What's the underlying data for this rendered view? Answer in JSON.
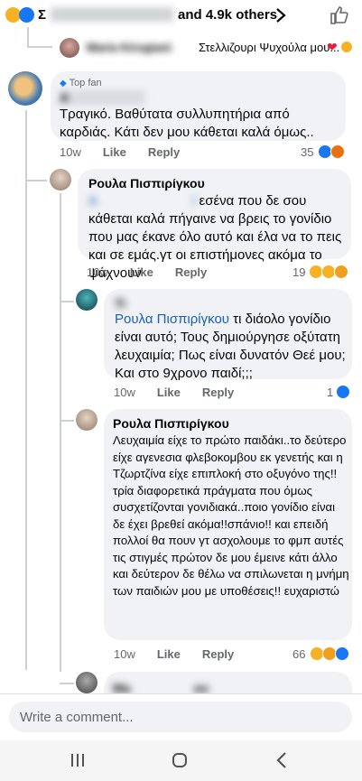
{
  "header": {
    "reactors_text": "Σ",
    "reactors_blur": "          ",
    "reactors_suffix": "and 4.9k others"
  },
  "preview_reply": {
    "name": "Maria Kirogiani",
    "text": "Στελλιζουρι Ψυχούλα μου..."
  },
  "comments": [
    {
      "badge": "Top fan",
      "name": "A      ",
      "text": "Τραγικό. Βαθύτατα συλλυπητήρια από καρδιάς. Κάτι δεν μου κάθεται καλά όμως..",
      "time": "10w",
      "like": "Like",
      "reply": "Reply",
      "reactions": "35"
    },
    {
      "name": "Ρουλα Πισπιρίγκου",
      "mention": "Α       ί",
      "text": " εσένα που δε σου κάθεται καλά πήγαινε να βρεις το γονίδιο που μας έκανε όλο αυτό και έλα να το πεις και σε εμάς.γτ οι επιστήμονες ακόμα το ψάχνουν",
      "time": "10w",
      "like": "Like",
      "reply": "Reply",
      "reactions": "19"
    },
    {
      "name": "Ti   ",
      "mention": "Ρουλα Πισπιρίγκου",
      "text": " τι διάολο γονίδιο είναι αυτό; Τους δημιούργησε οξύτατη λευχαιμία; Πως είναι δυνατόν Θεέ μου; Και στο 9χρονο παιδί;;;",
      "time": "10w",
      "like": "Like",
      "reply": "Reply",
      "reactions": "1"
    },
    {
      "name": "Ρουλα Πισπιρίγκου",
      "text": "Λευχαιμία είχε το πρώτο παιδάκι..το δεύτερο είχε αγενεσια φλεβοκομβου εκ γενετής και η Τζωρτζίνα είχε επιπλοκή στο οξυγόνο της!!τρία διαφορετικά πράγματα που όμως συσχετίζονται γονιδιακά..ποιο γονίδιο είναι δε έχει βρεθεί ακόμα!!σπάνιο!! και επειδή πολλοί θα πουν γτ ασχολουμε το φμπ αυτές τις στιγμές πρώτον δε μου έμεινε κάτι άλλο και δεύτερον δε θέλω να σπιλωνεται η μνήμη των παιδιών μου με υποθέσεις!! ευχαριστώ",
      "time": "10w",
      "like": "Like",
      "reply": "Reply",
      "reactions": "66"
    },
    {
      "name": "Ma     ου"
    }
  ],
  "composer": {
    "placeholder": "Write a comment..."
  },
  "colors": {
    "like_blue": "#1877f2",
    "mention": "#1b5fb5",
    "bubble": "#f0f2f5"
  }
}
